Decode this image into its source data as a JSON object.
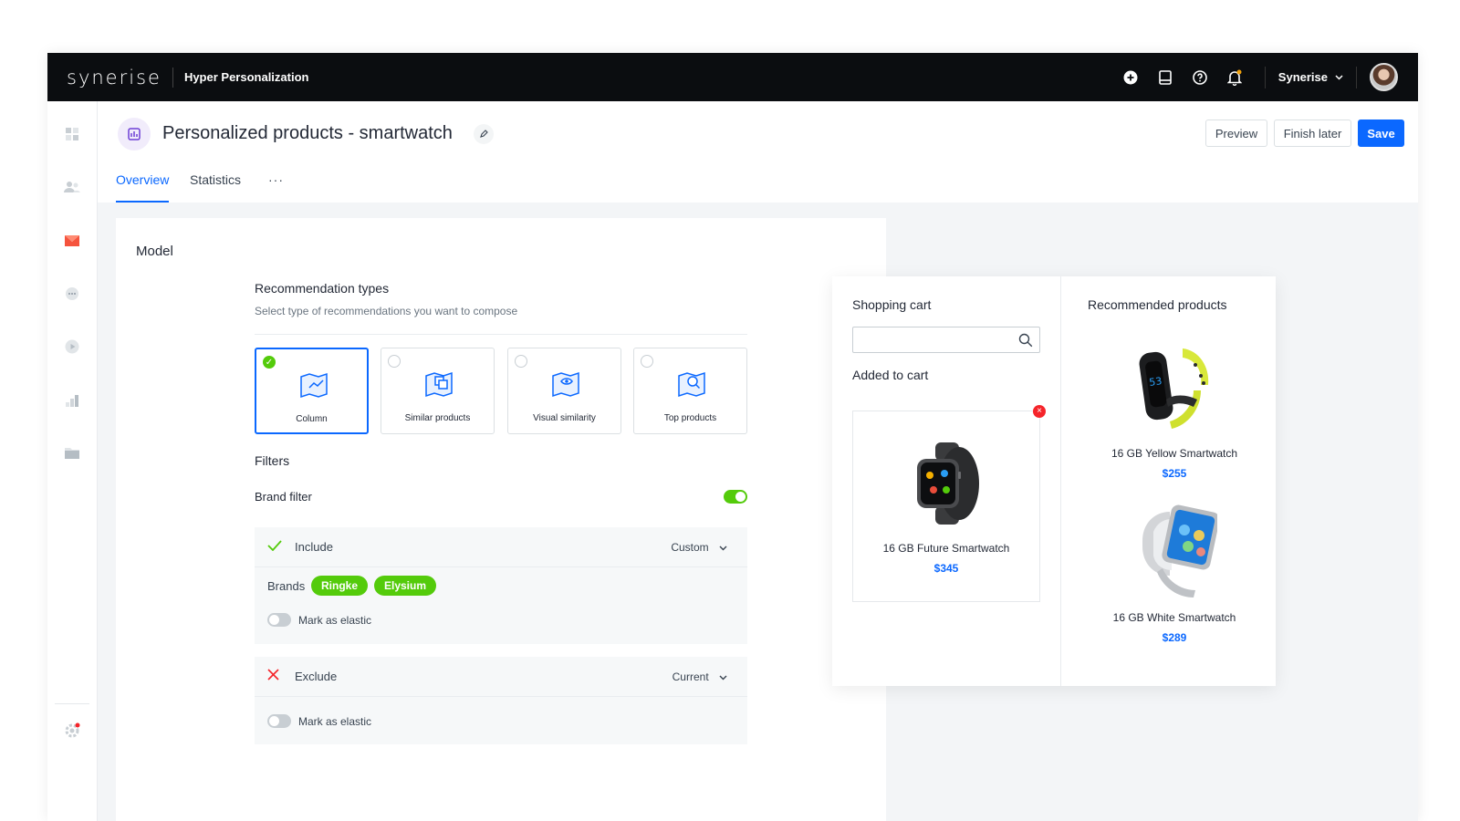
{
  "topbar": {
    "logo": "synerise",
    "app_name": "Hyper Personalization",
    "icons": [
      "plus-circle-icon",
      "book-icon",
      "help-icon",
      "bell-icon"
    ],
    "org_name": "Synerise"
  },
  "sidebar": {
    "icons": [
      "dashboard-icon",
      "people-icon",
      "campaign-icon",
      "chat-icon",
      "play-icon",
      "analytics-icon",
      "folder-icon",
      "settings-icon"
    ]
  },
  "header": {
    "title": "Personalized products - smartwatch",
    "buttons": {
      "preview": "Preview",
      "finish_later": "Finish later",
      "save": "Save"
    },
    "tabs": [
      "Overview",
      "Statistics",
      "···"
    ]
  },
  "model": {
    "title": "Model",
    "rec_types_title": "Recommendation types",
    "rec_types_subtitle": "Select type of recommendations you want to compose",
    "types": [
      {
        "label": "Column",
        "selected": true
      },
      {
        "label": "Similar products",
        "selected": false
      },
      {
        "label": "Visual similarity",
        "selected": false
      },
      {
        "label": "Top products",
        "selected": false
      }
    ],
    "filters_title": "Filters",
    "brand_filter_label": "Brand filter",
    "brand_filter_on": true,
    "include": {
      "label": "Include",
      "mode": "Custom",
      "brands_label": "Brands",
      "brands": [
        "Ringke",
        "Elysium"
      ],
      "elastic_label": "Mark as elastic"
    },
    "exclude": {
      "label": "Exclude",
      "mode": "Current",
      "elastic_label": "Mark as elastic"
    }
  },
  "preview": {
    "cart_title": "Shopping cart",
    "added_title": "Added to cart",
    "cart_product": {
      "name": "16 GB Future Smartwatch",
      "price": "$345"
    },
    "recommended_title": "Recommended products",
    "recommended": [
      {
        "name": "16 GB Yellow Smartwatch",
        "price": "$255"
      },
      {
        "name": "16 GB White Smartwatch",
        "price": "$289"
      }
    ]
  },
  "colors": {
    "accent": "#0b68ff",
    "success": "#54cb0b",
    "danger": "#f5242a",
    "topbar": "#0b0d10"
  }
}
